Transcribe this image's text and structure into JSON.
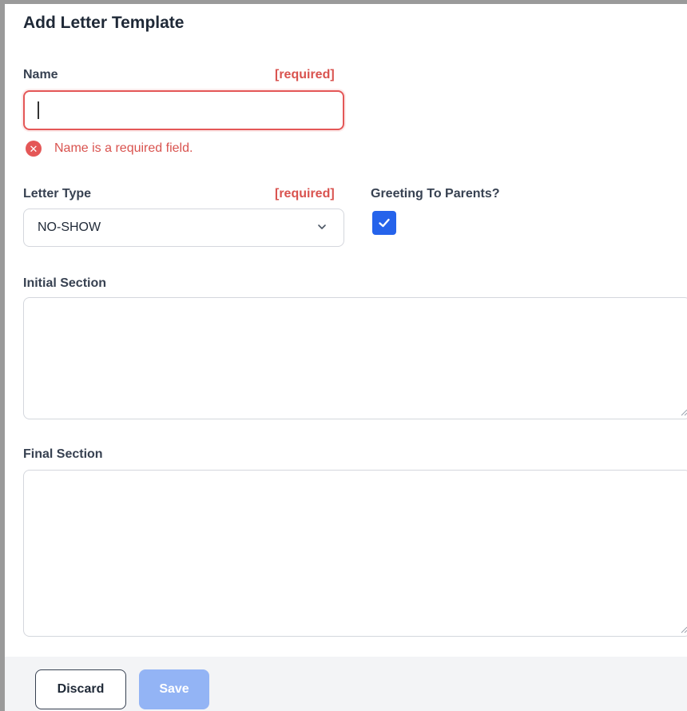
{
  "form": {
    "title": "Add Letter Template",
    "required_tag": "[required]",
    "name": {
      "label": "Name",
      "value": "",
      "error": "Name is a required field."
    },
    "letter_type": {
      "label": "Letter Type",
      "selected": "NO-SHOW"
    },
    "greeting": {
      "label": "Greeting To Parents?",
      "checked": true
    },
    "initial_section": {
      "label": "Initial Section",
      "value": ""
    },
    "final_section": {
      "label": "Final Section",
      "value": ""
    }
  },
  "footer": {
    "discard_label": "Discard",
    "save_label": "Save"
  },
  "colors": {
    "error": "#e45757",
    "accent": "#2563eb",
    "save_disabled": "#93b4f5"
  },
  "icons": {
    "error": "x-circle-icon",
    "dropdown": "chevron-down-icon",
    "checkbox": "check-icon",
    "resize": "resize-grip-icon"
  }
}
